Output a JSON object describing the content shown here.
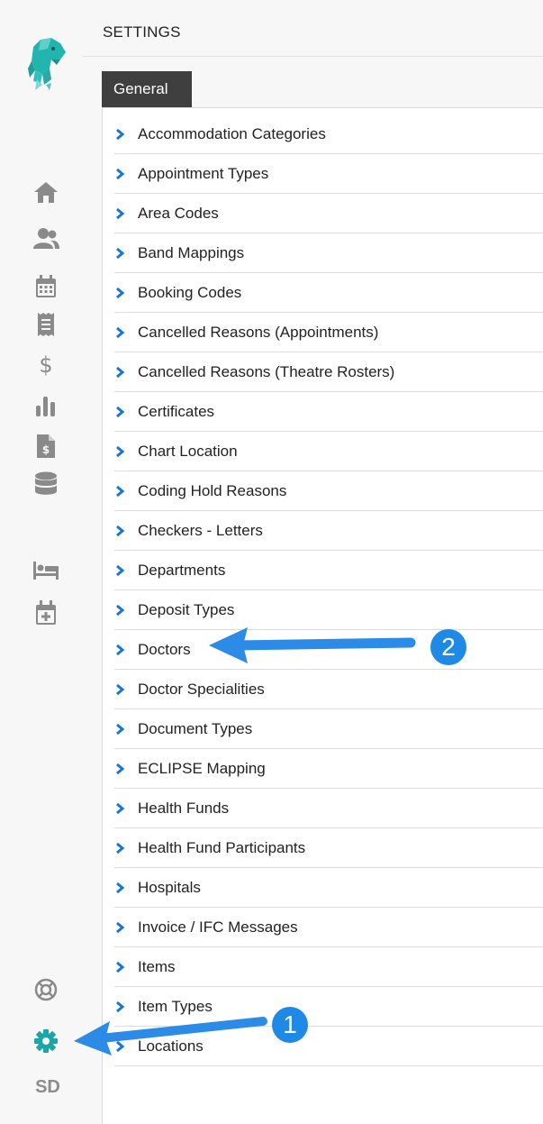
{
  "header": {
    "title": "SETTINGS"
  },
  "tabs": [
    {
      "label": "General"
    }
  ],
  "settings_list": [
    "Accommodation Categories",
    "Appointment Types",
    "Area Codes",
    "Band Mappings",
    "Booking Codes",
    "Cancelled Reasons (Appointments)",
    "Cancelled Reasons (Theatre Rosters)",
    "Certificates",
    "Chart Location",
    "Coding Hold Reasons",
    "Checkers - Letters",
    "Departments",
    "Deposit Types",
    "Doctors",
    "Doctor Specialities",
    "Document Types",
    "ECLIPSE Mapping",
    "Health Funds",
    "Health Fund Participants",
    "Hospitals",
    "Invoice / IFC Messages",
    "Items",
    "Item Types",
    "Locations"
  ],
  "sidebar": {
    "nav_icons": [
      "home-icon",
      "patients-icon",
      "calendar-icon",
      "receipt-icon",
      "billing-icon",
      "reports-icon",
      "invoice-icon",
      "database-icon",
      "bed-icon",
      "calendar-add-icon"
    ],
    "footer_icons": [
      "help-icon",
      "settings-icon"
    ],
    "dollar_glyph": "$",
    "user_initials": "SD"
  },
  "annotations": [
    {
      "label": "1"
    },
    {
      "label": "2"
    }
  ],
  "colors": {
    "accent_teal": "#1aa6a6",
    "chevron_blue": "#1976d2",
    "annotation_blue": "#1e8ae6",
    "tab_dark": "#3f3f3f",
    "icon_gray": "#8a8a8a"
  }
}
